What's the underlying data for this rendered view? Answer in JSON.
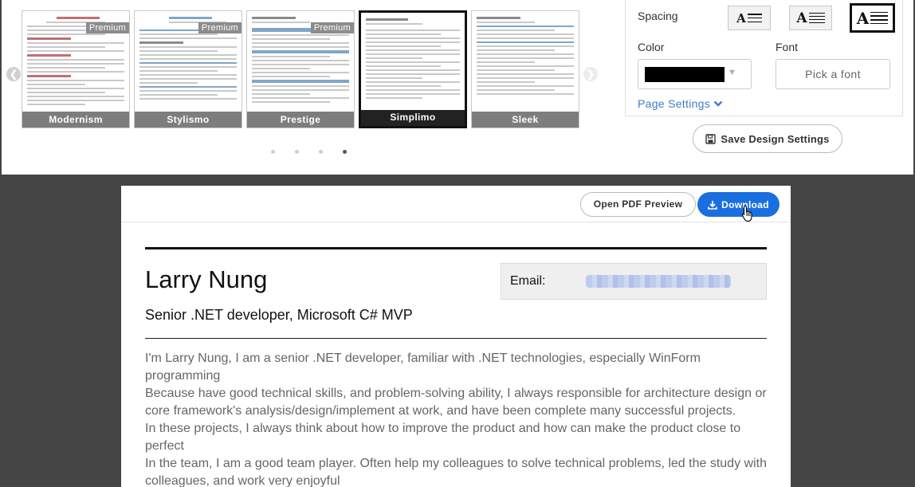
{
  "templates": [
    {
      "name": "Modernism",
      "badge": "Premium",
      "accent": "#c07070"
    },
    {
      "name": "Stylismo",
      "badge": "Premium",
      "accent": "#7fa6c9"
    },
    {
      "name": "Prestige",
      "badge": "Premium",
      "accent": "#5f86b0"
    },
    {
      "name": "Simplimo",
      "badge": "",
      "accent": "#8a8a8a"
    },
    {
      "name": "Sleek",
      "badge": "",
      "accent": "#7fa6c9"
    }
  ],
  "carousel": {
    "active_page": 4,
    "page_count": 4
  },
  "settings": {
    "spacing_label": "Spacing",
    "spacing_glyph": "A",
    "color_label": "Color",
    "color_value": "#000000",
    "font_label": "Font",
    "font_button": "Pick a font",
    "page_settings": "Page Settings",
    "save_button": "Save Design Settings"
  },
  "toolbar": {
    "pdf_preview": "Open PDF Preview",
    "download": "Download"
  },
  "resume": {
    "name": "Larry Nung",
    "title": "Senior .NET developer, Microsoft C# MVP",
    "email_label": "Email:",
    "summary": [
      "I'm Larry Nung, I am a senior .NET developer, familiar with .NET technologies, especially WinForm programming",
      "Because have good technical skills, and problem-solving ability, I always responsible for architecture design or core framework's analysis/design/implement at work, and have been complete many successful projects.",
      "In these projects, I always think about how to improve the product and how can make the product close to perfect",
      "In the team, I am a good team player. Often help my colleagues to solve technical problems, led the study with colleagues, and work very enjoyful"
    ]
  }
}
